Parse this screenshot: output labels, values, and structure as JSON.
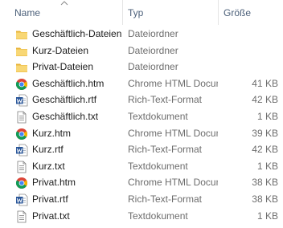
{
  "header": {
    "name_label": "Name",
    "type_label": "Typ",
    "size_label": "Größe"
  },
  "files": [
    {
      "name": "Geschäftlich-Dateien",
      "type": "Dateiordner",
      "size": "",
      "icon": "folder-icon"
    },
    {
      "name": "Kurz-Dateien",
      "type": "Dateiordner",
      "size": "",
      "icon": "folder-icon"
    },
    {
      "name": "Privat-Dateien",
      "type": "Dateiordner",
      "size": "",
      "icon": "folder-icon"
    },
    {
      "name": "Geschäftlich.htm",
      "type": "Chrome HTML Document",
      "size": "41 KB",
      "icon": "chrome-icon"
    },
    {
      "name": "Geschäftlich.rtf",
      "type": "Rich-Text-Format",
      "size": "42 KB",
      "icon": "word-icon"
    },
    {
      "name": "Geschäftlich.txt",
      "type": "Textdokument",
      "size": "1 KB",
      "icon": "text-file-icon"
    },
    {
      "name": "Kurz.htm",
      "type": "Chrome HTML Document",
      "size": "39 KB",
      "icon": "chrome-icon"
    },
    {
      "name": "Kurz.rtf",
      "type": "Rich-Text-Format",
      "size": "42 KB",
      "icon": "word-icon"
    },
    {
      "name": "Kurz.txt",
      "type": "Textdokument",
      "size": "1 KB",
      "icon": "text-file-icon"
    },
    {
      "name": "Privat.htm",
      "type": "Chrome HTML Document",
      "size": "38 KB",
      "icon": "chrome-icon"
    },
    {
      "name": "Privat.rtf",
      "type": "Rich-Text-Format",
      "size": "38 KB",
      "icon": "word-icon"
    },
    {
      "name": "Privat.txt",
      "type": "Textdokument",
      "size": "1 KB",
      "icon": "text-file-icon"
    }
  ]
}
